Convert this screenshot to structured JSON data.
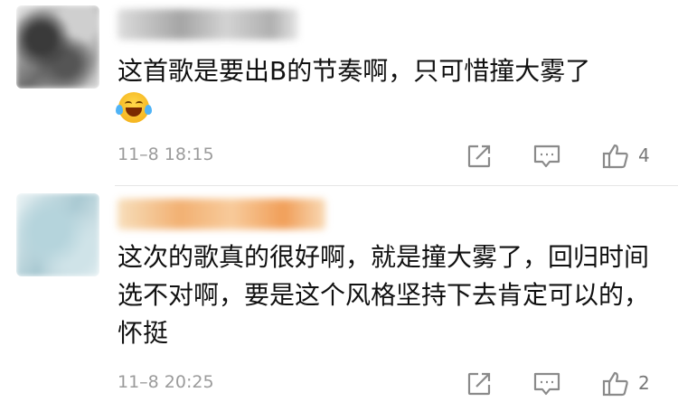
{
  "comments": [
    {
      "text": "这首歌是要出B的节奏啊，只可惜撞大雾了",
      "emoji": "laughing-crying-emoji",
      "timestamp": "11–8 18:15",
      "like_count": "4"
    },
    {
      "text": "这次的歌真的很好啊，就是撞大雾了，回归时间选不对啊，要是这个风格坚持下去肯定可以的，怀挺",
      "timestamp": "11–8 20:25",
      "like_count": "2"
    }
  ],
  "icons": {
    "share": "share-icon",
    "reply": "comment-icon",
    "like": "thumbs-up-icon"
  },
  "colors": {
    "text": "#111111",
    "meta": "#9b9b9b",
    "icon": "#8a8a8a",
    "divider": "#e6e6e6"
  }
}
